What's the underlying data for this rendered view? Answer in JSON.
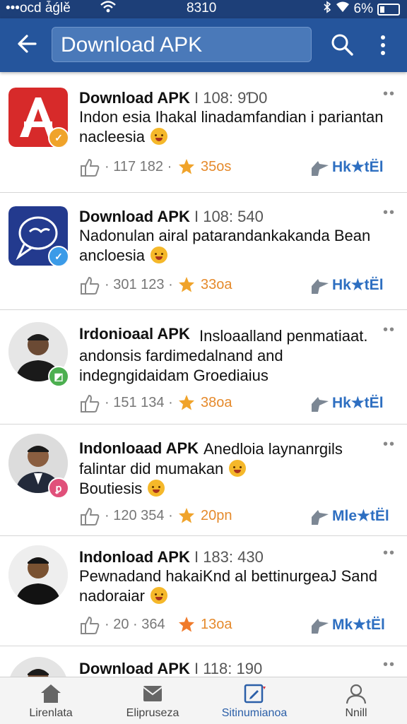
{
  "status_bar": {
    "carrier": "•••ocd ǡǵlĕ",
    "network_badge": "▾",
    "time": "8310",
    "battery": "6%"
  },
  "app_bar": {
    "search_value": "Download APK"
  },
  "feed": [
    {
      "title": "Download APK",
      "meta": "I 108: 9Ɗ0",
      "description": "Indon esia Ihakal linadamfandian i pariantan nacleesia",
      "count": "117 182",
      "rating": "35os",
      "share_label": "Hk★tЁl",
      "thumb_type": "app-icon-red",
      "badge_color": "#f0a32a"
    },
    {
      "title": "Download APK",
      "meta": "I 108: 540",
      "description": "Nadonulan airal patarandankakanda Bean ancloesia",
      "count": "301 123",
      "rating": "33oa",
      "share_label": "Hk★tЁl",
      "thumb_type": "app-icon-blue",
      "badge_color": "#3b9be8"
    },
    {
      "title": "Irdonioaal APK",
      "meta": "",
      "title_rest": "Insloaalland penmatiaat. andonsis  fardimedalnand and indegngidaidam Groediaius",
      "description": "",
      "count": "151 134",
      "rating": "38oa",
      "share_label": "Hk★tЁl",
      "thumb_type": "avatar",
      "badge_color": "#4caf50"
    },
    {
      "title": "Indonloaad APK",
      "meta": "",
      "title_rest": "Anedloia laynanrgils falintar did mumakan",
      "description": "Boutiesis",
      "count": "120 354",
      "rating": "20pn",
      "share_label": "Mle★tЁl",
      "thumb_type": "avatar",
      "badge_color": "#e0507a"
    },
    {
      "title": "Indonload APK",
      "meta": "I 183: 430",
      "description": "Pewnadand hakaiKnd al bettinurgeaJ Sand nadoraiar",
      "count": "20 · 364",
      "rating": "13oa",
      "share_label": "Mk★tЁl",
      "thumb_type": "avatar",
      "badge_color": ""
    },
    {
      "title": "Download APK",
      "meta": "I 118: 190",
      "description": "",
      "count": "",
      "rating": "",
      "share_label": "",
      "thumb_type": "avatar",
      "badge_color": ""
    }
  ],
  "bottom_nav": [
    {
      "label": "Lirenlata",
      "icon": "home-icon"
    },
    {
      "label": "Elipruseza",
      "icon": "inbox-icon"
    },
    {
      "label": "Sitinumianoa",
      "icon": "edit-icon"
    },
    {
      "label": "Nnill",
      "icon": "profile-icon"
    }
  ],
  "colors": {
    "app_bar": "#25559c",
    "status_bar": "#1d3f78",
    "rating": "#e58a2c",
    "share": "#2e6fc1"
  }
}
